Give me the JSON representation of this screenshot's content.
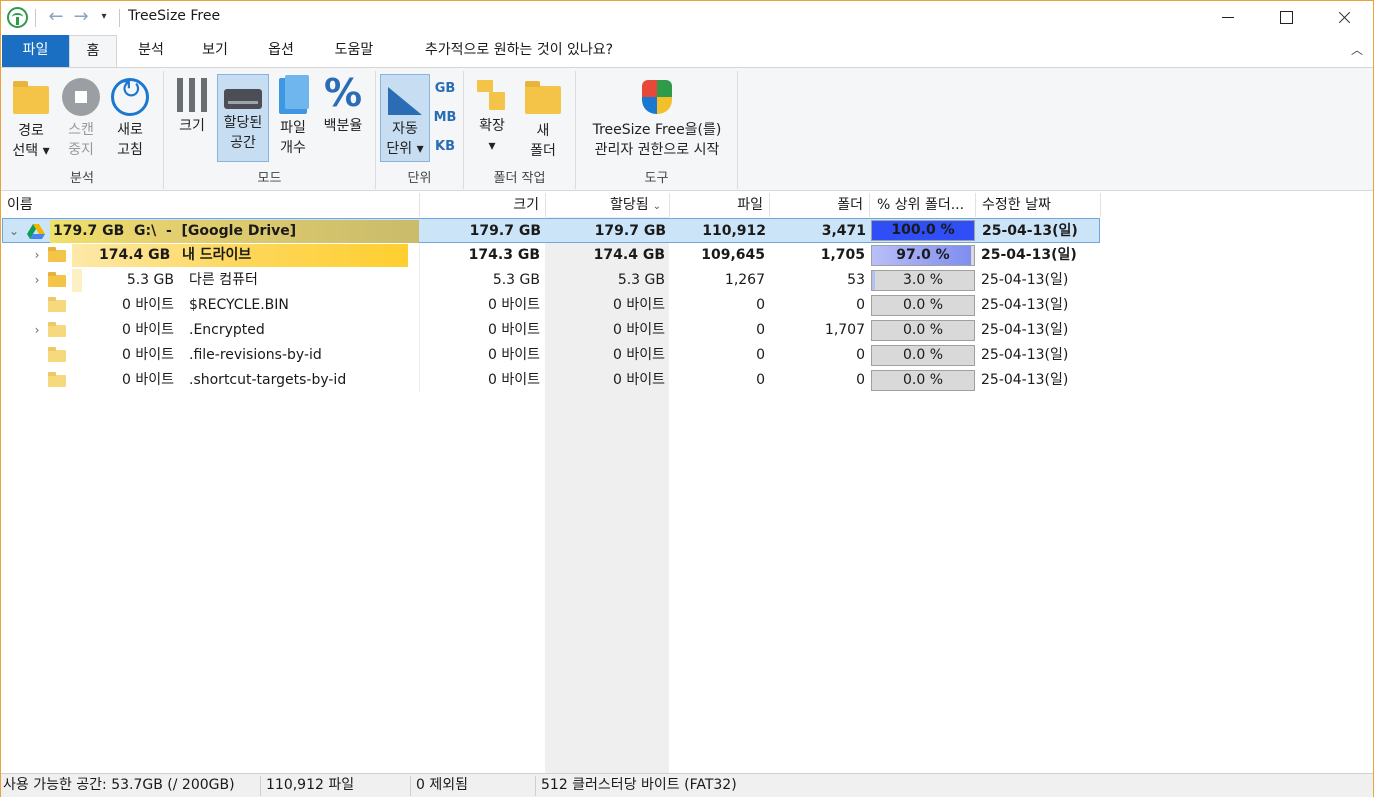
{
  "window": {
    "title": "TreeSize Free"
  },
  "tabs": {
    "file": "파일",
    "home": "홈",
    "analyze": "분석",
    "view": "보기",
    "options": "옵션",
    "help": "도움말",
    "tellme": "추가적으로 원하는 것이 있나요?"
  },
  "ribbon": {
    "groups": {
      "scan": "분석",
      "mode": "모드",
      "unit": "단위",
      "folder_ops": "폴더 작업",
      "tools": "도구"
    },
    "buttons": {
      "select_path": "경로\n선택 ▾",
      "stop_scan": "스캔\n중지",
      "refresh": "새로\n고침",
      "size": "크기",
      "allocated": "할당된\n공간",
      "file_count": "파일\n개수",
      "percent": "백분율",
      "auto_unit": "자동\n단위 ▾",
      "expand": "확장\n▾",
      "new_folder": "새\n폴더",
      "admin": "TreeSize Free을(를)\n관리자 권한으로 시작"
    },
    "units": {
      "gb": "GB",
      "mb": "MB",
      "kb": "KB"
    }
  },
  "columns": {
    "name": "이름",
    "size": "크기",
    "allocated": "할당됨",
    "files": "파일",
    "folders": "폴더",
    "pct_parent": "% 상위 폴더...",
    "modified": "수정한 날짜"
  },
  "rows": [
    {
      "twisty": "⌄",
      "name_size": "179.7 GB",
      "name": "G:\\  -  [Google Drive]",
      "size": "179.7 GB",
      "allocated": "179.7 GB",
      "files": "110,912",
      "folders": "3,471",
      "pct": "100.0 %",
      "pct_value": 100.0,
      "modified": "25-04-13(일)"
    },
    {
      "twisty": "›",
      "name_size": "174.4 GB",
      "name": "내 드라이브",
      "size": "174.3 GB",
      "allocated": "174.4 GB",
      "files": "109,645",
      "folders": "1,705",
      "pct": "97.0 %",
      "pct_value": 97.0,
      "modified": "25-04-13(일)"
    },
    {
      "twisty": "›",
      "name_size": "5.3 GB",
      "name": "다른 컴퓨터",
      "size": "5.3 GB",
      "allocated": "5.3 GB",
      "files": "1,267",
      "folders": "53",
      "pct": "3.0 %",
      "pct_value": 3.0,
      "modified": "25-04-13(일)"
    },
    {
      "twisty": "",
      "name_size": "0 바이트",
      "name": "$RECYCLE.BIN",
      "size": "0 바이트",
      "allocated": "0 바이트",
      "files": "0",
      "folders": "0",
      "pct": "0.0 %",
      "pct_value": 0.0,
      "modified": "25-04-13(일)"
    },
    {
      "twisty": "›",
      "name_size": "0 바이트",
      "name": ".Encrypted",
      "size": "0 바이트",
      "allocated": "0 바이트",
      "files": "0",
      "folders": "1,707",
      "pct": "0.0 %",
      "pct_value": 0.0,
      "modified": "25-04-13(일)"
    },
    {
      "twisty": "",
      "name_size": "0 바이트",
      "name": ".file-revisions-by-id",
      "size": "0 바이트",
      "allocated": "0 바이트",
      "files": "0",
      "folders": "0",
      "pct": "0.0 %",
      "pct_value": 0.0,
      "modified": "25-04-13(일)"
    },
    {
      "twisty": "",
      "name_size": "0 바이트",
      "name": ".shortcut-targets-by-id",
      "size": "0 바이트",
      "allocated": "0 바이트",
      "files": "0",
      "folders": "0",
      "pct": "0.0 %",
      "pct_value": 0.0,
      "modified": "25-04-13(일)"
    }
  ],
  "status": {
    "free_space": "사용 가능한 공간: 53.7GB  (/ 200GB)",
    "files": "110,912 파일",
    "excluded": "0 제외됨",
    "cluster": "512 클러스터당 바이트 (FAT32)"
  },
  "colors": {
    "accent": "#1b6fc2",
    "selection": "#cce4f7",
    "folder": "#f3c447",
    "pct_full": "#2f4ef5",
    "pct_high": "#7f8df0"
  }
}
